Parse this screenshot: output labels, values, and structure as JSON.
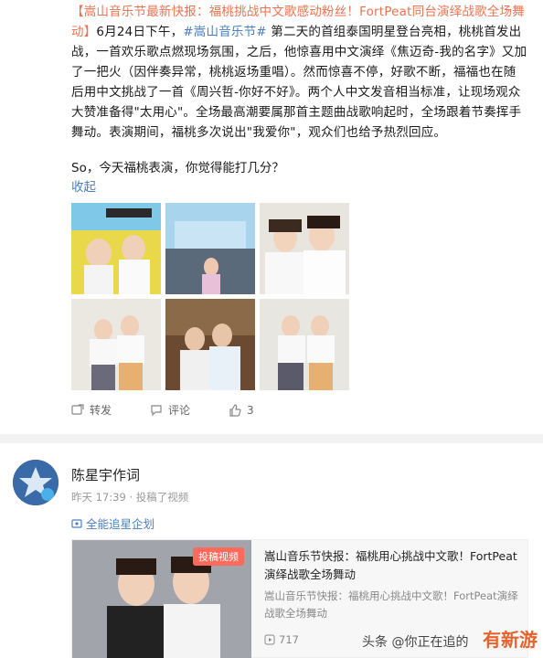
{
  "post": {
    "tag": "【嵩山音乐节最新快报：福桃挑战中文歌感动粉丝！FortPeat同台演绎战歌全场舞动】",
    "body1": "6月24日下午，",
    "hashtag": "#嵩山音乐节#",
    "body2": " 第二天的首组泰国明星登台亮相，桃桃首发出战，一首欢乐歌点燃现场氛围，之后，他惊喜用中文演绎《焦迈奇-我的名字》又加了一把火（因伴奏异常，桃桃返场重唱）。然而惊喜不停，好歌不断，福福也在随后用中文挑战了一首《周兴哲-你好不好》。两个人中文发音相当标准，让现场观众大赞准备得\"太用心\"。全场最高潮要属那首主题曲战歌响起时，全场跟着节奏挥手舞动。表演期间，福桃多次说出\"我爱你\"，观众们也给予热烈回应。",
    "question": "So，今天福桃表演，你觉得能打几分？",
    "collapse": "收起"
  },
  "actions": {
    "repost": "转发",
    "comment": "评论",
    "like_count": "3"
  },
  "reply": {
    "username": "陈星宇作词",
    "meta": "昨天 17:39 · 投稿了视频",
    "follow_link": "全能追星企划",
    "card": {
      "badge": "投稿视频",
      "title": "嵩山音乐节快报：福桃用心挑战中文歌！FortPeat演绎战歌全场舞动",
      "desc": "嵩山音乐节快报：福桃用心挑战中文歌！FortPeat演绎战歌全场舞动",
      "views": "717"
    }
  },
  "watermark": {
    "left": "头条 @你正在追的",
    "right": "有新游"
  },
  "colors": {
    "link": "#4a7fc1",
    "accent": "#eb7350",
    "badge": "#ff6a5b"
  }
}
